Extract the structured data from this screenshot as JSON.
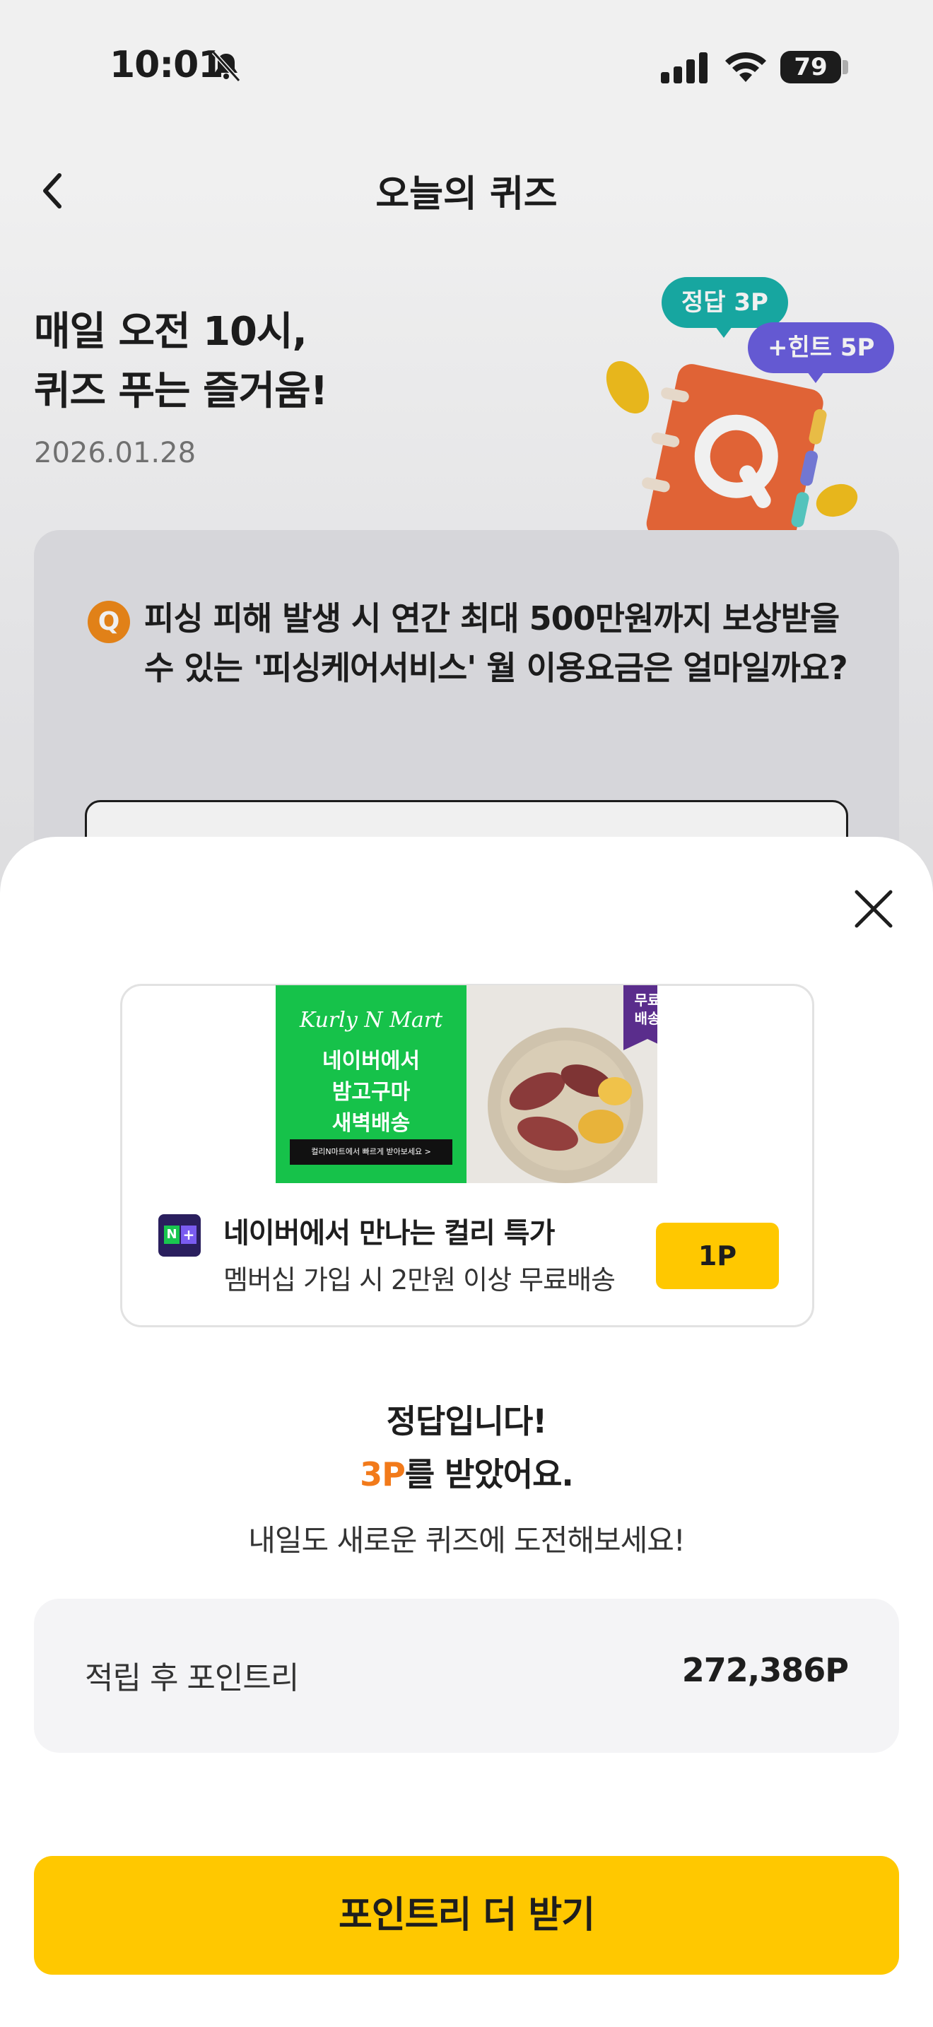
{
  "status_bar": {
    "time": "10:01",
    "battery": "79"
  },
  "header": {
    "title": "오늘의 퀴즈"
  },
  "hero": {
    "title_line1": "매일 오전 10시,",
    "title_line2": "퀴즈 푸는 즐거움!",
    "date": "2026.01.28",
    "bubble_correct": "정답 3P",
    "bubble_hint": "+힌트 5P"
  },
  "quiz": {
    "badge": "Q",
    "question": "피싱 피해 발생 시 연간 최대 500만원까지 보상받을 수 있는 '피싱케어서비스' 월 이용요금은 얼마일까요?"
  },
  "ad": {
    "banner_brand": "Kurly N Mart",
    "banner_headline_1": "네이버에서",
    "banner_headline_2": "밤고구마",
    "banner_headline_3": "새벽배송",
    "banner_cta": "컬리N마트에서 빠르게 받아보세요 >",
    "banner_badge_1": "무료",
    "banner_badge_2": "배송",
    "title": "네이버에서 만나는 컬리 특가",
    "description": "멤버십 가입 시 2만원 이상 무료배송",
    "point_button": "1P"
  },
  "result": {
    "title": "정답입니다!",
    "points_accent": "3P",
    "points_suffix": "를 받았어요.",
    "subtitle": "내일도 새로운 퀴즈에 도전해보세요!"
  },
  "balance": {
    "label": "적립 후 포인트리",
    "value": "272,386P"
  },
  "cta": {
    "label": "포인트리 더 받기"
  },
  "colors": {
    "accent_yellow": "#ffc800",
    "accent_orange": "#f27a1a",
    "teal": "#19b1ab",
    "purple": "#6b5fe0"
  }
}
